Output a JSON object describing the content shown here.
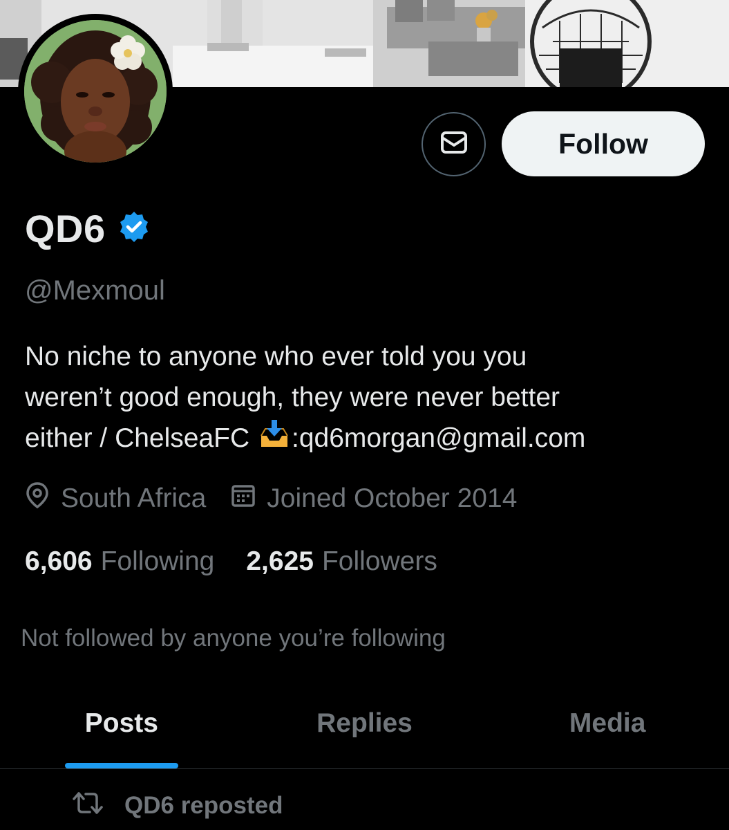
{
  "profile": {
    "display_name": "QD6",
    "handle": "@Mexmoul",
    "verified": true,
    "bio": {
      "line1": "No niche to anyone who ever told you you",
      "line2": "weren’t good enough, they were never better",
      "line3_prefix": "either / ChelseaFC ",
      "line3_email": ":qd6morgan@gmail.com"
    },
    "location": "South Africa",
    "joined": "Joined October 2014",
    "following_count": "6,606",
    "following_label": "Following",
    "followers_count": "2,625",
    "followers_label": "Followers",
    "not_followed_note": "Not followed by anyone you’re following"
  },
  "actions": {
    "follow_label": "Follow",
    "message_icon": "envelope-icon"
  },
  "tabs": [
    {
      "label": "Posts",
      "active": true
    },
    {
      "label": "Replies",
      "active": false
    },
    {
      "label": "Media",
      "active": false
    }
  ],
  "feed": {
    "repost_label": "QD6 reposted"
  },
  "colors": {
    "background": "#000000",
    "primary_text": "#e7e9ea",
    "secondary_text": "#71767b",
    "accent": "#1d9bf0",
    "follow_button_bg": "#eff3f4"
  }
}
